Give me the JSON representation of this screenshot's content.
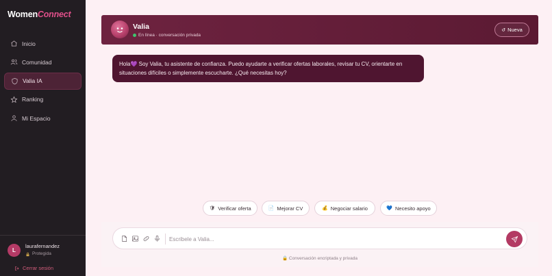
{
  "brand": {
    "name_main": "Women",
    "name_accent": "Connect",
    "accent_color": "#e04f8a"
  },
  "sidebar": {
    "items": [
      {
        "label": "Inicio",
        "icon": "home-icon",
        "active": false
      },
      {
        "label": "Comunidad",
        "icon": "users-icon",
        "active": false
      },
      {
        "label": "Valia IA",
        "icon": "shield-icon",
        "active": true
      },
      {
        "label": "Ranking",
        "icon": "star-icon",
        "active": false
      },
      {
        "label": "Mi Espacio",
        "icon": "user-icon",
        "active": false
      }
    ],
    "user": {
      "initial": "L",
      "name": "laurafernandez",
      "status": "Protegida"
    },
    "logout_label": "Cerrar sesión"
  },
  "chat": {
    "bot_name": "Valia",
    "status_text": "En línea · conversación privada",
    "status_color": "#3ec46d",
    "new_button_label": "Nueva",
    "greeting": "Hola💜 Soy Valia, tu asistente de confianza. Puedo ayudarte a verificar ofertas laborales, revisar tu CV, orientarte en situaciones difíciles o simplemente escucharte. ¿Qué necesitas hoy?"
  },
  "suggestions": [
    {
      "icon": "🛡",
      "label": "Verificar oferta"
    },
    {
      "icon": "📄",
      "label": "Mejorar CV"
    },
    {
      "icon": "💰",
      "label": "Negociar salario"
    },
    {
      "icon": "💙",
      "label": "Necesito apoyo"
    }
  ],
  "composer": {
    "placeholder": "Escribele a Valia...",
    "footer_note": "🔒 Conversación encriptada y privada"
  },
  "colors": {
    "sidebar_bg": "#221d22",
    "header_bg": "#6e2340",
    "bubble_bg": "#4f1530",
    "send_bg": "#b33a63",
    "page_bg": "#fdf0f4"
  }
}
